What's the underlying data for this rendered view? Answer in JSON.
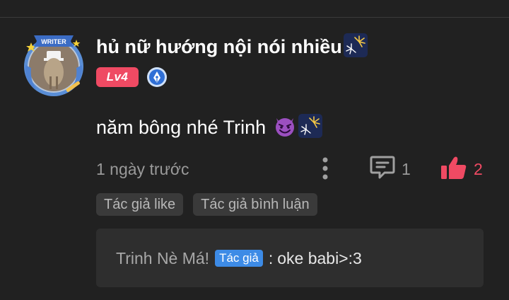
{
  "comment": {
    "username": "hủ nữ hướng nội nói nhiều",
    "username_emoji": "fireworks-emoji",
    "level_label": "Lv4",
    "avatar_badge_text": "WRITER",
    "text": "năm bông nhé Trinh",
    "text_emojis": [
      "smiling-devil-emoji",
      "fireworks-emoji"
    ],
    "timestamp": "1 ngày trước",
    "reply_count": "1",
    "like_count": "2",
    "tags": [
      "Tác giả like",
      "Tác giả bình luận"
    ]
  },
  "reply": {
    "author": "Trinh Nè Má!",
    "author_tag": "Tác giả",
    "separator": ":",
    "text": "oke babi>:3"
  },
  "colors": {
    "background": "#212121",
    "level_badge": "#ef4a63",
    "like": "#ef4a63",
    "author_tag": "#3d8be6",
    "tag_bg": "#3a3a3a",
    "reply_bg": "#2e2e2e"
  }
}
